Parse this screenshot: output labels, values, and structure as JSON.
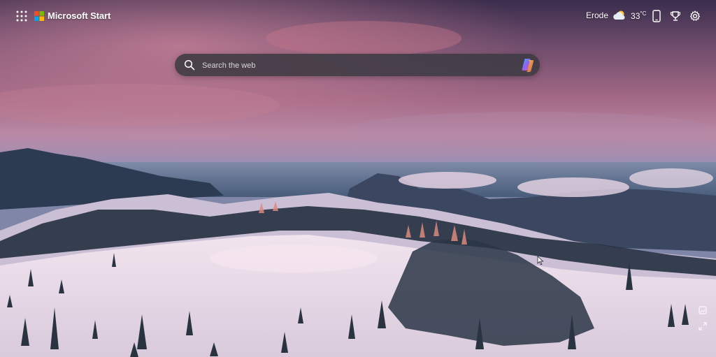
{
  "header": {
    "brand_name": "Microsoft Start",
    "weather": {
      "city": "Erode",
      "temperature": "33",
      "unit": "°C",
      "icon": "partly-cloudy-icon"
    },
    "icons": [
      "app-launcher-icon",
      "phone-icon",
      "rewards-trophy-icon",
      "gear-icon"
    ]
  },
  "search": {
    "placeholder": "Search the web",
    "value": "",
    "copilot_icon": "copilot-icon"
  },
  "side_controls": [
    "image-info-icon",
    "expand-icon"
  ],
  "colors": {
    "sky_top": "#3b2e4e",
    "sky_pink": "#c57d96",
    "horizon": "#8b7fa8",
    "snow": "#e9dfe9",
    "tree": "#233040",
    "search_bg": "#3c3a42"
  }
}
